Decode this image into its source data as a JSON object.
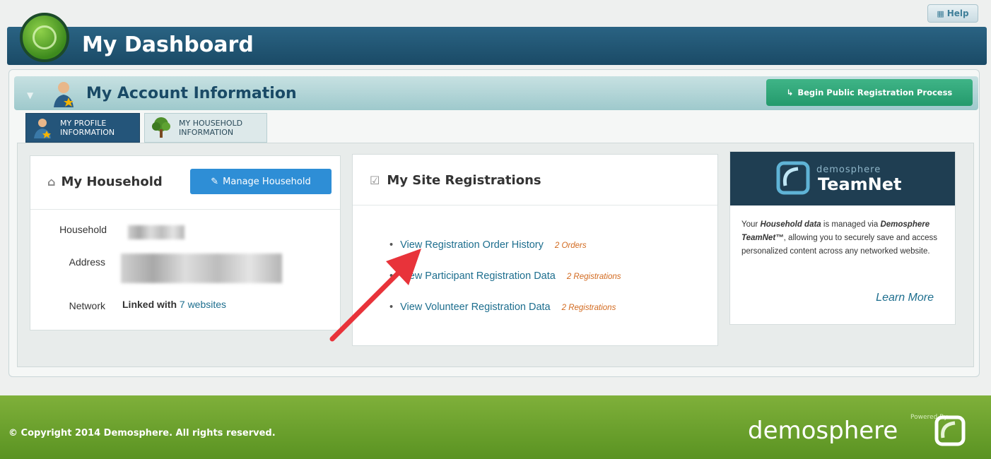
{
  "help": {
    "label": "Help",
    "icon": "chat-icon"
  },
  "dashboard": {
    "title": "My Dashboard",
    "logo_icon": "crosshair-globe-icon"
  },
  "account": {
    "title": "My Account Information",
    "begin_button": "Begin Public Registration Process",
    "tabs": [
      {
        "line1": "MY PROFILE",
        "line2": "INFORMATION",
        "icon": "user-star-icon",
        "active": true
      },
      {
        "line1": "MY HOUSEHOLD",
        "line2": "INFORMATION",
        "icon": "tree-icon",
        "active": false
      }
    ]
  },
  "household": {
    "title": "My Household",
    "manage_button": "Manage Household",
    "labels": {
      "household": "Household",
      "address": "Address",
      "network": "Network"
    },
    "network": {
      "prefix": "Linked with",
      "link": "7 websites"
    }
  },
  "registrations": {
    "title": "My Site Registrations",
    "items": [
      {
        "label": "View Registration Order History",
        "count": "2 Orders"
      },
      {
        "label": "View Participant Registration Data",
        "count": "2 Registrations"
      },
      {
        "label": "View Volunteer Registration Data",
        "count": "2 Registrations"
      }
    ]
  },
  "teamnet": {
    "brand_small": "demosphere",
    "brand_big": "TeamNet",
    "text_1": "Your ",
    "text_bold_1": "Household data",
    "text_2": " is managed via ",
    "text_bold_2": "Demosphere TeamNet™",
    "text_3": ", allowing you to securely save and access personalized content across any networked website.",
    "learn_more": "Learn More"
  },
  "footer": {
    "copyright": "© Copyright 2014 Demosphere. All rights reserved.",
    "powered_by": "Powered By",
    "brand": "demosphere"
  },
  "colors": {
    "header": "#1f5578",
    "accent_green": "#249a6c",
    "link": "#1d6e8e",
    "count": "#d2691e",
    "footer": "#6aa32c"
  }
}
